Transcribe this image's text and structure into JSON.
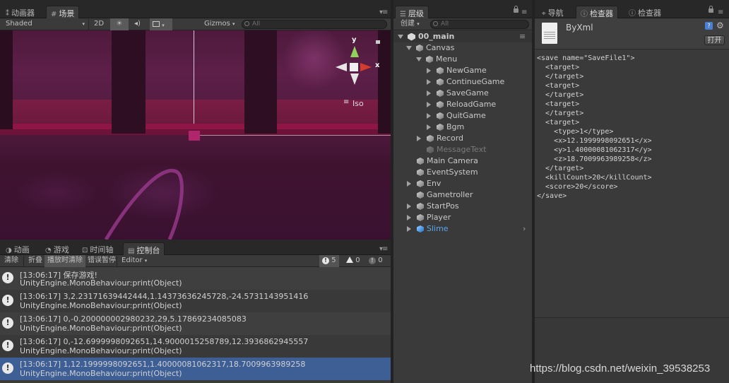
{
  "scene_panel": {
    "tabs": [
      {
        "label": "动画器",
        "icon": "animator-icon"
      },
      {
        "label": "场景",
        "icon": "grid-icon"
      }
    ],
    "toolbar": {
      "shading": "Shaded",
      "mode_2d": "2D",
      "gizmos": "Gizmos",
      "search_placeholder": "All"
    },
    "gizmo": {
      "y_label": "y",
      "x_label": "x",
      "projection": "Iso"
    }
  },
  "console_panel": {
    "tabs": [
      {
        "label": "动画",
        "icon": "animation-icon"
      },
      {
        "label": "游戏",
        "icon": "game-icon"
      },
      {
        "label": "时间轴",
        "icon": "timeline-icon"
      },
      {
        "label": "控制台",
        "icon": "console-icon"
      }
    ],
    "toolbar": {
      "clear": "清除",
      "collapse": "折叠",
      "clear_on_play": "播放时清除",
      "error_pause": "错误暂停",
      "editor": "Editor",
      "log_count": "5",
      "warn_count": "0",
      "error_count": "0"
    },
    "logs": [
      {
        "line1": "[13:06:17] 保存游戏!",
        "line2": "UnityEngine.MonoBehaviour:print(Object)"
      },
      {
        "line1": "[13:06:17] 3,2.23171639442444,1.14373636245728,-24.5731143951416",
        "line2": "UnityEngine.MonoBehaviour:print(Object)"
      },
      {
        "line1": "[13:06:17] 0,-0.200000002980232,29,5.17869234085083",
        "line2": "UnityEngine.MonoBehaviour:print(Object)"
      },
      {
        "line1": "[13:06:17] 0,-12.6999998092651,14.9000015258789,12.3936862945557",
        "line2": "UnityEngine.MonoBehaviour:print(Object)"
      },
      {
        "line1": "[13:06:17] 1,12.1999998092651,1.40000081062317,18.7009963989258",
        "line2": "UnityEngine.MonoBehaviour:print(Object)"
      }
    ]
  },
  "hierarchy_panel": {
    "tab": "层级",
    "create": "创建",
    "search_placeholder": "All",
    "scene_name": "00_main",
    "items": [
      {
        "label": "Canvas"
      },
      {
        "label": "Menu"
      },
      {
        "label": "NewGame"
      },
      {
        "label": "ContinueGame"
      },
      {
        "label": "SaveGame"
      },
      {
        "label": "ReloadGame"
      },
      {
        "label": "QuitGame"
      },
      {
        "label": "Bgm"
      },
      {
        "label": "Record"
      },
      {
        "label": "MessageText"
      },
      {
        "label": "Main Camera"
      },
      {
        "label": "EventSystem"
      },
      {
        "label": "Env"
      },
      {
        "label": "Gametroller"
      },
      {
        "label": "StartPos"
      },
      {
        "label": "Player"
      },
      {
        "label": "Slime"
      }
    ]
  },
  "inspector_panel": {
    "tabs": [
      {
        "label": "导航",
        "icon": "navigation-icon"
      },
      {
        "label": "检查器",
        "icon": "info-icon"
      },
      {
        "label": "检查器",
        "icon": "info-icon"
      }
    ],
    "file_name": "ByXml",
    "open_button": "打开",
    "xml_lines": [
      "<save name=\"SaveFile1\">",
      "  <target>",
      "  </target>",
      "  <target>",
      "  </target>",
      "  <target>",
      "  </target>",
      "  <target>",
      "    <type>1</type>",
      "    <x>12.1999998092651</x>",
      "    <y>1.40000081062317</y>",
      "    <z>18.7009963989258</z>",
      "  </target>",
      "  <killCount>20</killCount>",
      "  <score>20</score>",
      "</save>"
    ]
  },
  "watermark": "https://blog.csdn.net/weixin_39538253",
  "colors": {
    "selection": "#3e5f96",
    "scene_bg": "#4e1a3c",
    "crimson": "#9a1444",
    "slime_blue": "#5aa6ee"
  }
}
